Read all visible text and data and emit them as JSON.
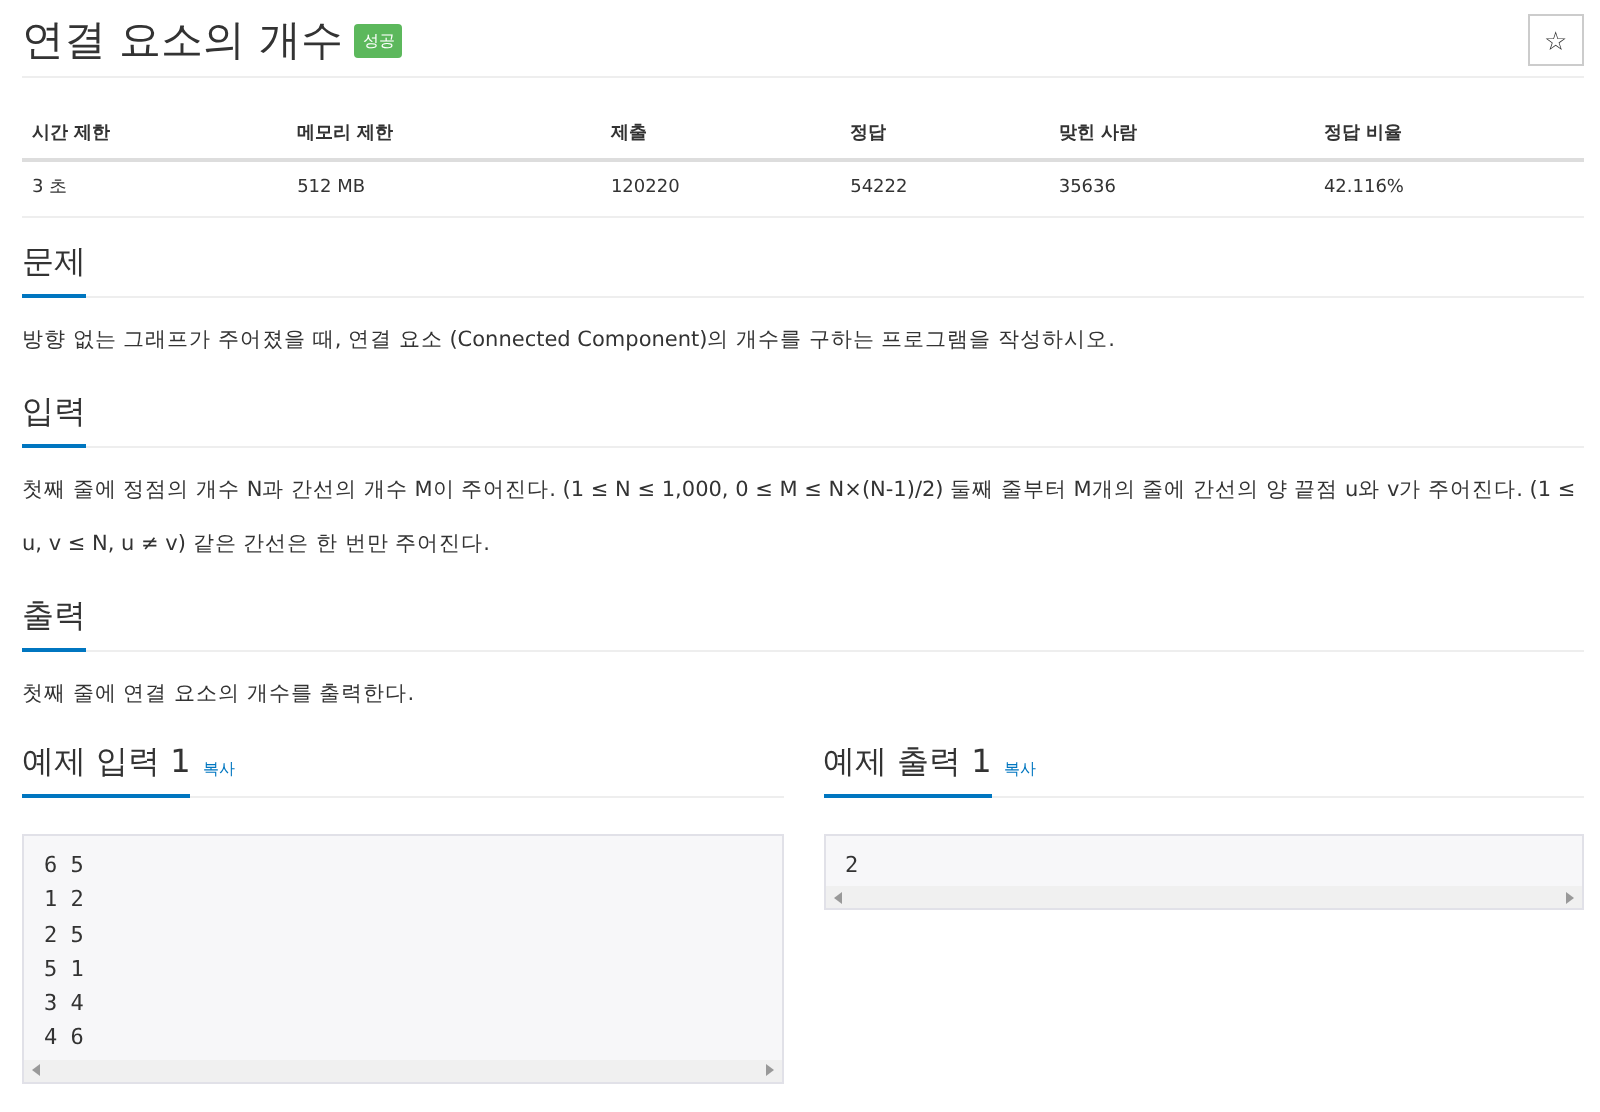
{
  "title": "연결 요소의 개수",
  "badge": "성공",
  "star_button": "☆",
  "limits": {
    "columns": [
      "시간 제한",
      "메모리 제한",
      "제출",
      "정답",
      "맞힌 사람",
      "정답 비율"
    ],
    "values": [
      "3 초",
      "512 MB",
      "120220",
      "54222",
      "35636",
      "42.116%"
    ]
  },
  "sections": [
    {
      "heading": "문제",
      "paragraphs": [
        "방향 없는 그래프가 주어졌을 때, 연결 요소 (Connected Component)의 개수를 구하는 프로그램을 작성하시오."
      ]
    },
    {
      "heading": "입력",
      "paragraphs": [
        "첫째 줄에 정점의 개수 N과 간선의 개수 M이 주어진다. (1 ≤ N ≤ 1,000, 0 ≤ M ≤ N×(N-1)/2) 둘째 줄부터 M개의 줄에 간선의 양 끝점 u와 v가 주어진다. (1 ≤ u, v ≤ N, u ≠ v) 같은 간선은 한 번만 주어진다."
      ]
    },
    {
      "heading": "출력",
      "paragraphs": [
        "첫째 줄에 연결 요소의 개수를 출력한다."
      ]
    }
  ],
  "samples": [
    {
      "heading": "예제 입력 1",
      "copy": "복사",
      "lines": [
        "6 5",
        "1 2",
        "2 5",
        "5 1",
        "3 4",
        "4 6"
      ]
    },
    {
      "heading": "예제 출력 1",
      "copy": "복사",
      "lines": [
        "2"
      ]
    }
  ]
}
